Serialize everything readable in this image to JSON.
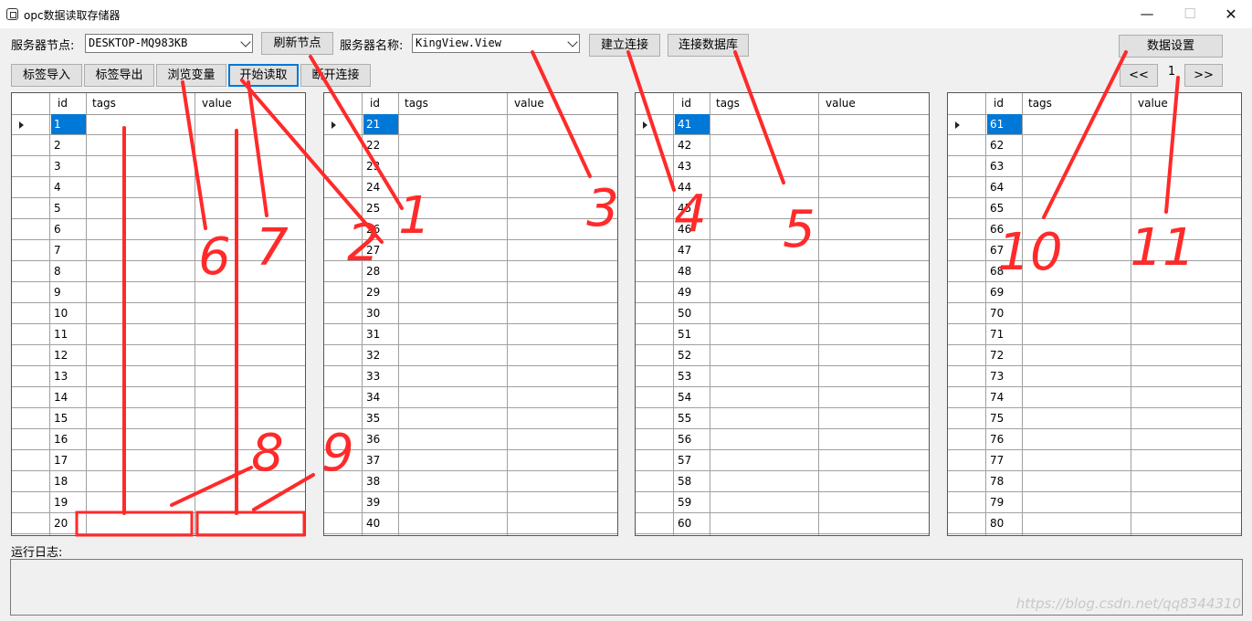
{
  "window": {
    "title": "opc数据读取存储器"
  },
  "toolbar": {
    "server_node_label": "服务器节点:",
    "server_node_value": "DESKTOP-MQ983KB",
    "refresh_nodes": "刷新节点",
    "server_name_label": "服务器名称:",
    "server_name_value": "KingView.View",
    "connect": "建立连接",
    "connect_db": "连接数据库",
    "data_settings": "数据设置",
    "import_tags": "标签导入",
    "export_tags": "标签导出",
    "browse_vars": "浏览变量",
    "start_read": "开始读取",
    "disconnect": "断开连接",
    "prev_page": "<<",
    "page": "1",
    "next_page": ">>"
  },
  "grid_columns": {
    "id": "id",
    "tags": "tags",
    "value": "value"
  },
  "grids": [
    {
      "ids": [
        "1",
        "2",
        "3",
        "4",
        "5",
        "6",
        "7",
        "8",
        "9",
        "10",
        "11",
        "12",
        "13",
        "14",
        "15",
        "16",
        "17",
        "18",
        "19",
        "20"
      ]
    },
    {
      "ids": [
        "21",
        "22",
        "23",
        "24",
        "25",
        "26",
        "27",
        "28",
        "29",
        "30",
        "31",
        "32",
        "33",
        "34",
        "35",
        "36",
        "37",
        "38",
        "39",
        "40"
      ]
    },
    {
      "ids": [
        "41",
        "42",
        "43",
        "44",
        "45",
        "46",
        "47",
        "48",
        "49",
        "50",
        "51",
        "52",
        "53",
        "54",
        "55",
        "56",
        "57",
        "58",
        "59",
        "60"
      ]
    },
    {
      "ids": [
        "61",
        "62",
        "63",
        "64",
        "65",
        "66",
        "67",
        "68",
        "69",
        "70",
        "71",
        "72",
        "73",
        "74",
        "75",
        "76",
        "77",
        "78",
        "79",
        "80"
      ]
    }
  ],
  "log": {
    "label": "运行日志:"
  },
  "watermark": "https://blog.csdn.net/qq8344310",
  "annotations": [
    "1",
    "2",
    "3",
    "4",
    "5",
    "6",
    "7",
    "8",
    "9",
    "10",
    "11"
  ],
  "colors": {
    "annotation": "#ff2a2a",
    "selection": "#0078d7"
  }
}
